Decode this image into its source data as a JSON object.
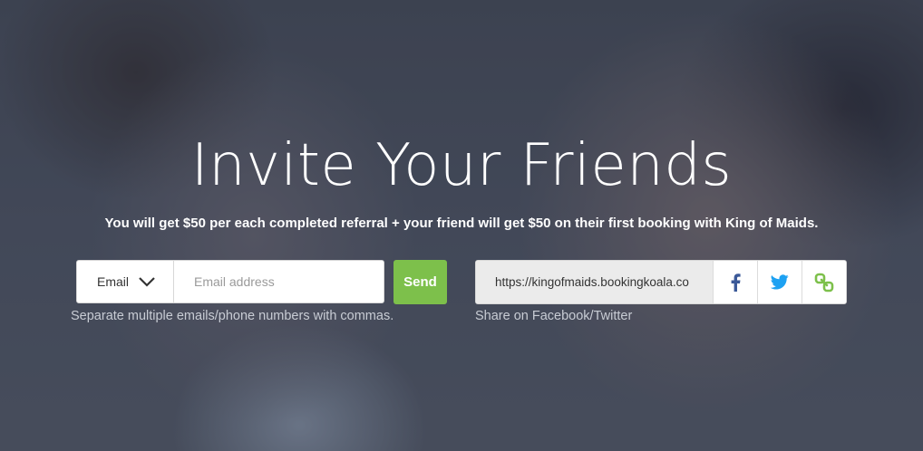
{
  "hero": {
    "title": "Invite Your Friends",
    "subtitle": "You will get $50 per each completed referral + your friend will get $50 on their first booking with King of Maids."
  },
  "invite_form": {
    "method_select": {
      "selected": "Email",
      "icon": "chevron-down-icon"
    },
    "email_input": {
      "placeholder": "Email address",
      "value": ""
    },
    "send_label": "Send",
    "hint": "Separate multiple emails/phone numbers with commas."
  },
  "share": {
    "url": "https://kingofmaids.bookingkoala.co",
    "buttons": [
      {
        "icon": "facebook-icon",
        "color": "#3b5998"
      },
      {
        "icon": "twitter-icon",
        "color": "#1da1f2"
      },
      {
        "icon": "link-icon",
        "color": "#7dc04b"
      }
    ],
    "label": "Share on Facebook/Twitter"
  },
  "colors": {
    "accent_green": "#7dc04b",
    "text_light": "#c8ccd4"
  }
}
